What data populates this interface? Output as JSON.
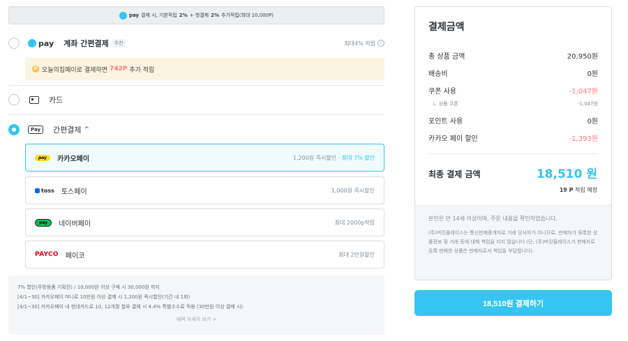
{
  "banner": {
    "pay_mark": "pay",
    "text_prefix": "결제 시, 기본적립",
    "rate1": "2%",
    "text_mid": "+ 첫결제",
    "rate2": "2%",
    "text_suffix": "추가적립(최대 10,000P)"
  },
  "methods": {
    "ohou_pay": {
      "logo": "pay",
      "title": "계좌 간편결제",
      "badge": "추천",
      "right": "최대4% 적립",
      "info_icon": "i",
      "point_prefix": "오늘의집페이로 결제하면",
      "point_amount": "742P",
      "point_suffix": "추가 적립",
      "point_coin": "P"
    },
    "card": {
      "title": "카드"
    },
    "easy": {
      "icon_text": "Pay",
      "title": "간편결제",
      "chevron": "^"
    }
  },
  "easy_options": [
    {
      "logo": "pay",
      "name": "카카오페이",
      "right": "1,200원 즉시할인",
      "right_hl": "· 최대 7% 할인"
    },
    {
      "logo": "toss",
      "name": "토스페이",
      "right": "1,000원 즉시할인",
      "right_hl": ""
    },
    {
      "logo": "pay",
      "name": "네이버페이",
      "right": "최대 2000p적립",
      "right_hl": ""
    },
    {
      "logo": "PAYCO",
      "name": "페이코",
      "right": "최대 2만원할인",
      "right_hl": ""
    }
  ],
  "notice": {
    "lines": [
      "7% 할인(주방용품 기획전) / 10,000원 이상 구매 시 30,000원 까지",
      "[4/1~30] 카카오페이 머니로 10만원 이상 결제 시 1,200원 즉시할인(기간 내 1회)",
      "[4/1~30] 카카오페이 내 현대카드로 10, 12개월 할부 결제 시 4.4% 특별수수료 적용 (30만원 이상 결제 시)"
    ],
    "more": "혜택 자세히 보기 >"
  },
  "summary": {
    "title": "결제금액",
    "lines": [
      {
        "label": "총 상품 금액",
        "value": "20,950원",
        "neg": false
      },
      {
        "label": "배송비",
        "value": "0원",
        "neg": false
      },
      {
        "label": "쿠폰 사용",
        "value": "-1,047원",
        "neg": true
      },
      {
        "label": "ㄴ 상품 쿠폰",
        "value": "-1,047원",
        "neg": false
      },
      {
        "label": "포인트 사용",
        "value": "0원",
        "neg": false
      },
      {
        "label": "카카오 페이 할인",
        "value": "-1,393원",
        "neg": true
      }
    ],
    "final_label": "최종 결제 금액",
    "final_value": "18,510 원",
    "points_value": "19 P",
    "points_suffix": "적립 예정",
    "agree": "본인은 만 14세 이상이며, 주문 내용을 확인하였습니다.",
    "disclaimer": "(주)버킷플레이스는 통신판매중개자로 거래 당사자가 아니므로, 판매자가 등록한 상품정보 및 거래 등에 대해 책임을 지지 않습니다 (단, (주)버킷플레이스가 판매자로 등록 판매한 상품은 판매자로서 책임을 부담합니다)."
  },
  "pay_button": "18,510원 결제하기",
  "colors": {
    "accent": "#35c5f0",
    "negative": "#ff7777",
    "kakao": "#ffe300",
    "naver": "#03c75a",
    "payco": "#e0001b"
  }
}
